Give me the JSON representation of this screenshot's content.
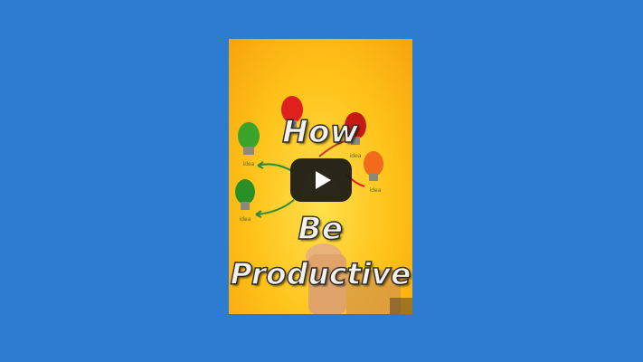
{
  "page": {
    "background_color": "#2e7ccf"
  },
  "video": {
    "caption_line1": "How",
    "caption_line2": "Be",
    "caption_line3": "Productive",
    "bulb_label": "idea",
    "play_icon": "play-icon"
  },
  "colors": {
    "frame_yellow": "#ffc21a",
    "bulb_green": "#3aa52a",
    "bulb_red": "#e0201c",
    "bulb_orange": "#f26a1b",
    "arrow_green": "#2e8b3a",
    "player_button": "#171717"
  }
}
